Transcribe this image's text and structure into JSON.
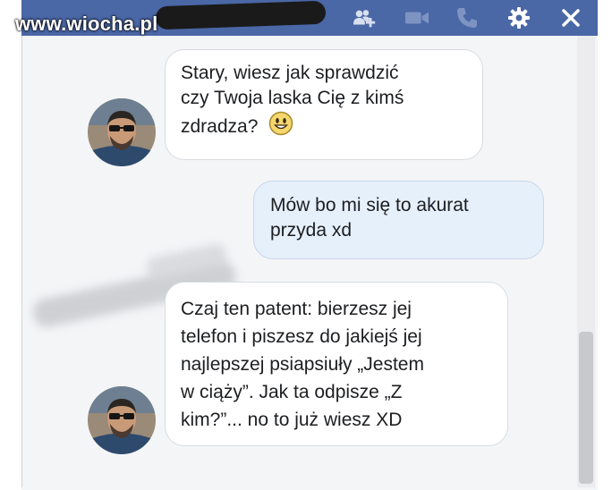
{
  "watermark": "www.wiocha.pl",
  "header": {
    "icons": [
      "add-friends-icon",
      "video-call-icon",
      "phone-call-icon",
      "settings-icon",
      "close-icon"
    ],
    "icon_color": "#ffffff",
    "background": "#4a67a6"
  },
  "messages": [
    {
      "sender": "contact",
      "lines": [
        "Stary, wiesz jak sprawdzić",
        "czy Twoja laska Cię z kimś",
        "zdradza?"
      ],
      "emoji": "smiley-icon"
    },
    {
      "sender": "me",
      "lines": [
        "Mów bo mi się to akurat",
        "przyda xd"
      ]
    },
    {
      "sender": "contact",
      "lines": [
        "Czaj ten patent: bierzesz jej",
        "telefon i piszesz do jakiejś jej",
        "najlepszej psiapsiuły „Jestem",
        "w ciąży”. Jak ta odpisze „Z",
        "kim?”... no to już wiesz XD"
      ]
    }
  ]
}
